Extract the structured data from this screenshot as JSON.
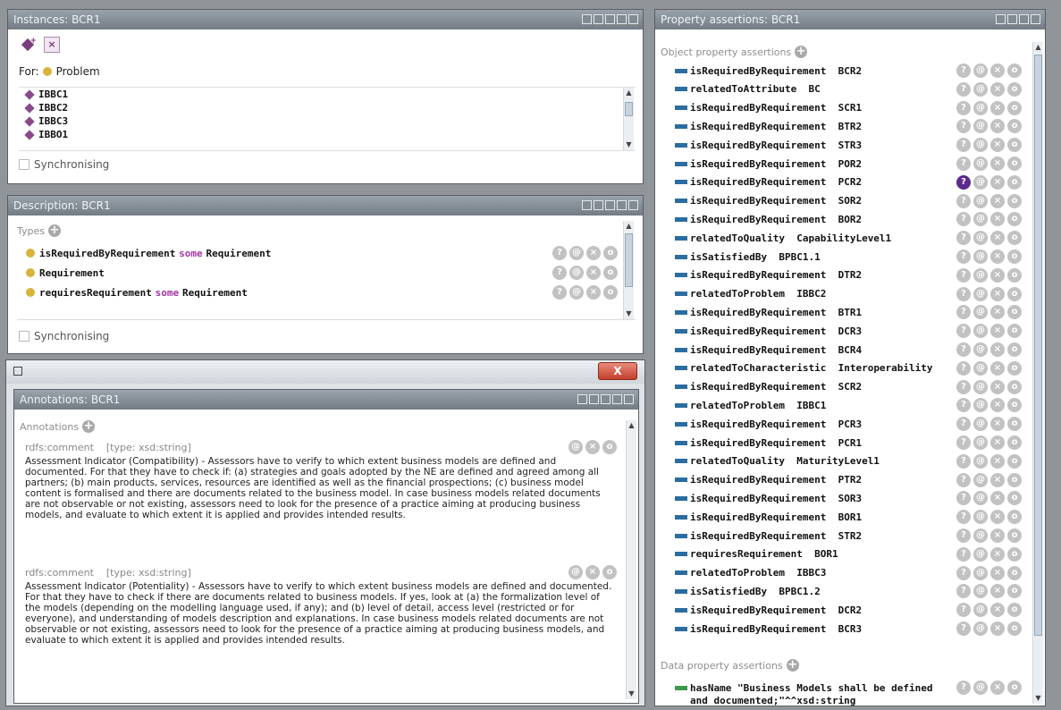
{
  "instances": {
    "title": "Instances: BCR1",
    "for_label": "For:",
    "for_class": "Problem",
    "items": [
      "IBBC1",
      "IBBC2",
      "IBBC3",
      "IBBO1"
    ],
    "sync_label": "Synchronising",
    "icons": [
      "add-individual-icon",
      "delete-individual-icon"
    ]
  },
  "description": {
    "title": "Description: BCR1",
    "section": "Types",
    "types": [
      {
        "a": "isRequiredByRequirement",
        "kw": "some",
        "b": "Requirement"
      },
      {
        "a": "Requirement",
        "kw": "",
        "b": ""
      },
      {
        "a": "requiresRequirement",
        "kw": "some",
        "b": "Requirement"
      }
    ],
    "sync_label": "Synchronising"
  },
  "annotations": {
    "title": "Annotations: BCR1",
    "close_label": "X",
    "section": "Annotations",
    "items": [
      {
        "prop": "rdfs:comment",
        "type": "[type: xsd:string]",
        "text": "Assessment Indicator (Compatibility) - Assessors have to verify to which extent business models are defined and documented. For that they have to check if: (a) strategies and goals adopted by the NE are defined and agreed among all partners; (b) main products, services, resources are identified as well as the financial prospections; (c) business model content is formalised and there are documents related to the business model. In case business models related documents are not observable or not existing, assessors need to look for the presence of a practice aiming at producing business models, and evaluate to which extent it is applied and provides intended results."
      },
      {
        "prop": "rdfs:comment",
        "type": "[type: xsd:string]",
        "text": "Assessment Indicator (Potentiality) - Assessors have to verify to which extent business models are defined and documented. For that they have to check if there are documents related to business models. If yes, look at (a) the formalization level of the models (depending on the modelling language used, if any); and (b) level of detail, access level (restricted or for everyone), and understanding of models description and explanations. In case business models related documents are not observable or not existing, assessors need to look for the presence of a practice aiming at producing business models, and evaluate to which extent it is applied and provides intended results."
      }
    ]
  },
  "properties": {
    "title": "Property assertions: BCR1",
    "object_section": "Object property assertions",
    "object_assertions": [
      {
        "prop": "isRequiredByRequirement",
        "value": "BCR2"
      },
      {
        "prop": "relatedToAttribute",
        "value": "BC"
      },
      {
        "prop": "isRequiredByRequirement",
        "value": "SCR1"
      },
      {
        "prop": "isRequiredByRequirement",
        "value": "BTR2"
      },
      {
        "prop": "isRequiredByRequirement",
        "value": "STR3"
      },
      {
        "prop": "isRequiredByRequirement",
        "value": "POR2"
      },
      {
        "prop": "isRequiredByRequirement",
        "value": "PCR2"
      },
      {
        "prop": "isRequiredByRequirement",
        "value": "SOR2"
      },
      {
        "prop": "isRequiredByRequirement",
        "value": "BOR2"
      },
      {
        "prop": "relatedToQuality",
        "value": "CapabilityLevel1"
      },
      {
        "prop": "isSatisfiedBy",
        "value": "BPBC1.1"
      },
      {
        "prop": "isRequiredByRequirement",
        "value": "DTR2"
      },
      {
        "prop": "relatedToProblem",
        "value": "IBBC2"
      },
      {
        "prop": "isRequiredByRequirement",
        "value": "BTR1"
      },
      {
        "prop": "isRequiredByRequirement",
        "value": "DCR3"
      },
      {
        "prop": "isRequiredByRequirement",
        "value": "BCR4"
      },
      {
        "prop": "relatedToCharacteristic",
        "value": "Interoperability"
      },
      {
        "prop": "isRequiredByRequirement",
        "value": "SCR2"
      },
      {
        "prop": "relatedToProblem",
        "value": "IBBC1"
      },
      {
        "prop": "isRequiredByRequirement",
        "value": "PCR3"
      },
      {
        "prop": "isRequiredByRequirement",
        "value": "PCR1"
      },
      {
        "prop": "relatedToQuality",
        "value": "MaturityLevel1"
      },
      {
        "prop": "isRequiredByRequirement",
        "value": "PTR2"
      },
      {
        "prop": "isRequiredByRequirement",
        "value": "SOR3"
      },
      {
        "prop": "isRequiredByRequirement",
        "value": "BOR1"
      },
      {
        "prop": "isRequiredByRequirement",
        "value": "STR2"
      },
      {
        "prop": "requiresRequirement",
        "value": "BOR1"
      },
      {
        "prop": "relatedToProblem",
        "value": "IBBC3"
      },
      {
        "prop": "isSatisfiedBy",
        "value": "BPBC1.2"
      },
      {
        "prop": "isRequiredByRequirement",
        "value": "DCR2"
      },
      {
        "prop": "isRequiredByRequirement",
        "value": "BCR3"
      }
    ],
    "data_section": "Data property assertions",
    "data_assertion_line1": "hasName \"Business Models shall be defined",
    "data_assertion_line2": "and documented;\"^^xsd:string"
  }
}
